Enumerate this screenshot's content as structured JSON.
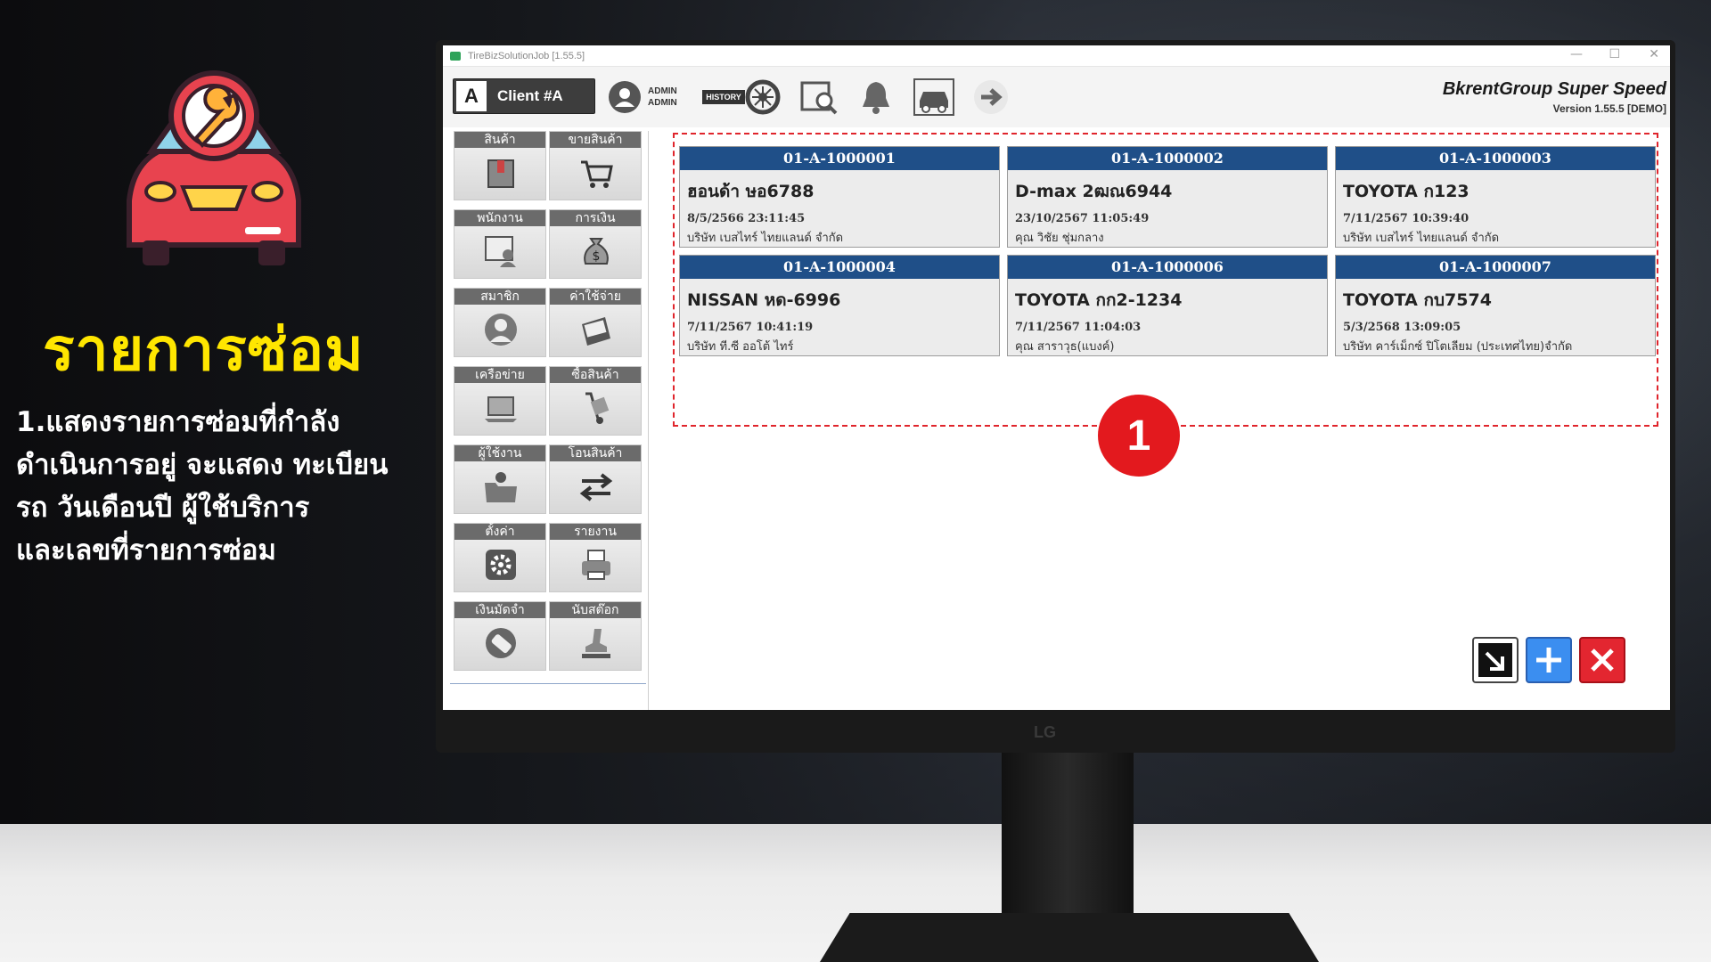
{
  "promo": {
    "title": "รายการซ่อม",
    "desc_lines": [
      "1.แสดงรายการซ่อมที่กำลัง",
      "ดำเนินการอยู่ จะแสดง ทะเบียน",
      "รถ วันเดือนปี ผู้ใช้บริการ",
      "และเลขที่รายการซ่อม"
    ],
    "icon": "car-repair-wrench-icon"
  },
  "window": {
    "title": "TireBizSolutionJob [1.55.5]"
  },
  "toolbar": {
    "client_badge": "A",
    "client_label": "Client #A",
    "admin_line1": "ADMIN",
    "admin_line2": "ADMIN",
    "history_label": "HISTORY",
    "brand_title": "BkrentGroup Super Speed",
    "brand_version": "Version 1.55.5 [DEMO]"
  },
  "sidebar": {
    "items": [
      {
        "label": "สินค้า",
        "icon": "box-icon"
      },
      {
        "label": "ขายสินค้า",
        "icon": "cart-icon"
      },
      {
        "label": "พนักงาน",
        "icon": "employee-icon"
      },
      {
        "label": "การเงิน",
        "icon": "money-bag-icon"
      },
      {
        "label": "สมาชิก",
        "icon": "member-icon"
      },
      {
        "label": "ค่าใช้จ่าย",
        "icon": "wallet-icon"
      },
      {
        "label": "เครือข่าย",
        "icon": "laptop-icon"
      },
      {
        "label": "ซื้อสินค้า",
        "icon": "hand-truck-icon"
      },
      {
        "label": "ผู้ใช้งาน",
        "icon": "user-folder-icon"
      },
      {
        "label": "โอนสินค้า",
        "icon": "transfer-icon"
      },
      {
        "label": "ตั้งค่า",
        "icon": "settings-icon"
      },
      {
        "label": "รายงาน",
        "icon": "printer-icon"
      },
      {
        "label": "เงินมัดจำ",
        "icon": "deposit-icon"
      },
      {
        "label": "นับสต๊อก",
        "icon": "stamp-icon"
      }
    ]
  },
  "jobs": [
    {
      "id": "01-A-1000001",
      "plate": "ฮอนด้า ษอ6788",
      "date": "8/5/2566 23:11:45",
      "customer": "บริษัท เบสไทร์ ไทยแลนด์ จำกัด"
    },
    {
      "id": "01-A-1000002",
      "plate": "D-max 2ฒณ6944",
      "date": "23/10/2567 11:05:49",
      "customer": "คุณ วิชัย ชุ่มกลาง"
    },
    {
      "id": "01-A-1000003",
      "plate": "TOYOTA ก123",
      "date": "7/11/2567 10:39:40",
      "customer": "บริษัท เบสไทร์ ไทยแลนด์ จำกัด"
    },
    {
      "id": "01-A-1000004",
      "plate": "NISSAN หด-6996",
      "date": "7/11/2567 10:41:19",
      "customer": "บริษัท ที.ซี ออโต้ ไทร์"
    },
    {
      "id": "01-A-1000006",
      "plate": "TOYOTA กก2-1234",
      "date": "7/11/2567 11:04:03",
      "customer": "คุณ สาราวุธ(แบงค์)"
    },
    {
      "id": "01-A-1000007",
      "plate": "TOYOTA กบ7574",
      "date": "5/3/2568 13:09:05",
      "customer": "บริษัท คาร์เม็กซ์ ปิโตเลียม (ประเทศไทย)จำกัด"
    }
  ],
  "annotation": {
    "marker": "1"
  },
  "monitor": {
    "brand": "LG"
  },
  "colors": {
    "card_header": "#1f4f88",
    "marker": "#e3191e",
    "promo_title": "#ffe600"
  }
}
